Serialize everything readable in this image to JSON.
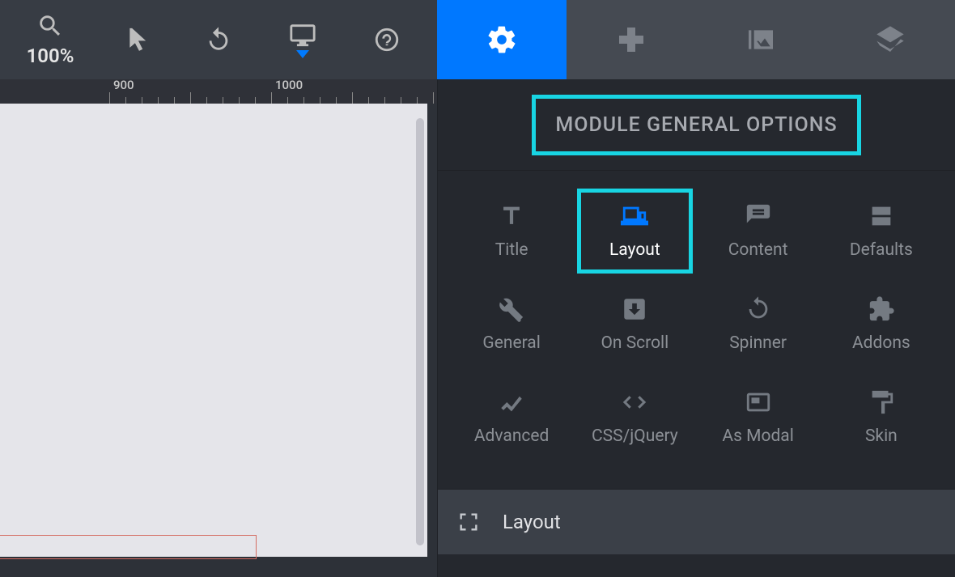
{
  "toolbar": {
    "zoom_label": "100%"
  },
  "ruler": {
    "marks": [
      "900",
      "1000"
    ]
  },
  "panel": {
    "title": "MODULE GENERAL OPTIONS",
    "options": [
      {
        "label": "Title",
        "icon": "title"
      },
      {
        "label": "Layout",
        "icon": "layout",
        "active": true
      },
      {
        "label": "Content",
        "icon": "content"
      },
      {
        "label": "Defaults",
        "icon": "defaults"
      },
      {
        "label": "General",
        "icon": "general"
      },
      {
        "label": "On Scroll",
        "icon": "onscroll"
      },
      {
        "label": "Spinner",
        "icon": "spinner"
      },
      {
        "label": "Addons",
        "icon": "addons"
      },
      {
        "label": "Advanced",
        "icon": "advanced"
      },
      {
        "label": "CSS/jQuery",
        "icon": "cssjq"
      },
      {
        "label": "As Modal",
        "icon": "asmodal"
      },
      {
        "label": "Skin",
        "icon": "skin"
      }
    ],
    "footer_label": "Layout"
  },
  "tabs": [
    {
      "icon": "gear",
      "active": true
    },
    {
      "icon": "dpad"
    },
    {
      "icon": "slides"
    },
    {
      "icon": "layers"
    }
  ]
}
